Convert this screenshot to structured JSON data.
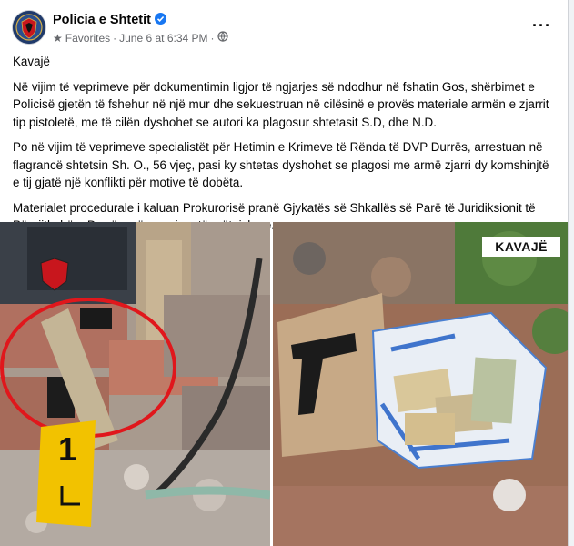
{
  "post": {
    "page_name": "Policia e Shtetit",
    "audience": "Favorites",
    "separator": "·",
    "date": "June 6 at 6:34 PM",
    "more_label": "···"
  },
  "content": {
    "location": "Kavajë",
    "paragraph1": "Në vijim të veprimeve për dokumentimin ligjor të ngjarjes së ndodhur në fshatin Gos, shërbimet e Policisë gjetën  të fshehur në një mur dhe sekuestruan në cilësinë e provës  materiale armën e zjarrit tip pistoletë, me të cilën dyshohet se autori ka plagosur shtetasit S.D, dhe N.D.",
    "paragraph2": "Po në vijim të veprimeve specialistët për Hetimin e Krimeve të Rënda të DVP Durrës, arrestuan në flagrancë shtetsin Sh. O., 56 vjeç, pasi ky shtetas  dyshohet se plagosi me armë zjarri dy komshinjtë e tij gjatë një konflikti për motive të dobëta.",
    "paragraph3": "Materialet procedurale i kaluan Prokurorisë pranë Gjykatës së Shkallës së Parë të Juridiksionit të Përgjithshëm Durrës, për veprime të mëtejshme."
  },
  "photos": {
    "right_badge": "KAVAJË",
    "evidence_marker": "1"
  },
  "colors": {
    "accent": "#1877f2",
    "text": "#050505",
    "secondary_text": "#65676b",
    "circle": "#e0171c",
    "marker": "#f2c200"
  }
}
